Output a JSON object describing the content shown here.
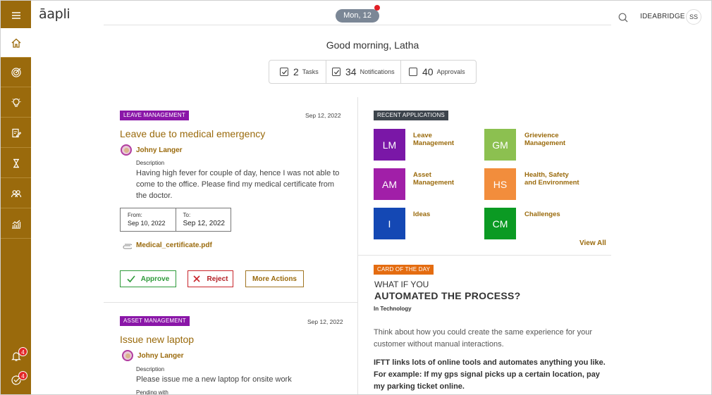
{
  "header": {
    "logo": "āapli",
    "date": "Mon, 12",
    "org": "IDEABRIDGE",
    "user_initials": "SS"
  },
  "greeting": "Good morning, Latha",
  "summary": [
    {
      "count": "2",
      "label": "Tasks",
      "checked": true
    },
    {
      "count": "34",
      "label": "Notifications",
      "checked": true
    },
    {
      "count": "40",
      "label": "Approvals",
      "checked": false
    }
  ],
  "sidebar": {
    "items": [
      {
        "icon": "menu-icon"
      },
      {
        "icon": "home-icon"
      },
      {
        "icon": "target-icon"
      },
      {
        "icon": "lightbulb-icon"
      },
      {
        "icon": "edit-note-icon"
      },
      {
        "icon": "trophy-icon"
      },
      {
        "icon": "users-icon"
      },
      {
        "icon": "analytics-icon"
      }
    ],
    "bell_badge": "4",
    "tasks_badge": "4"
  },
  "card1": {
    "tag": "LEAVE MANAGEMENT",
    "date": "Sep 12, 2022",
    "title": "Leave due to medical emergency",
    "user": "Johny Langer",
    "desc_label": "Description",
    "desc_lines": [
      "Having high fever for couple of day, hence I was not able to",
      "come to the office. Please find my medical certificate from",
      "the doctor."
    ],
    "from_label": "From:",
    "from_value": "Sep 10, 2022",
    "to_label": "To:",
    "to_value": "Sep 12, 2022",
    "attachment": "Medical_certificate.pdf",
    "approve": "Approve",
    "reject": "Reject",
    "more": "More Actions"
  },
  "card2": {
    "tag": "ASSET MANAGEMENT",
    "date": "Sep 12, 2022",
    "title": "Issue new laptop",
    "user": "Johny Langer",
    "desc_label": "Description",
    "desc": "Please issue me a new laptop for onsite work",
    "pending_label": "Pending with"
  },
  "recent": {
    "tag": "RECENT APPLICATIONS",
    "apps": [
      {
        "abbr": "LM",
        "line1": "Leave",
        "line2": "Management",
        "color": "#7a17a7"
      },
      {
        "abbr": "GM",
        "line1": "Grievience",
        "line2": "Management",
        "color": "#8cc050"
      },
      {
        "abbr": "AM",
        "line1": "Asset",
        "line2": "Management",
        "color": "#a11fa8"
      },
      {
        "abbr": "HS",
        "line1": "Health, Safety",
        "line2": "and Environment",
        "color": "#f28d3c"
      },
      {
        "abbr": "I",
        "line1": "Ideas",
        "line2": "",
        "color": "#1448b4"
      },
      {
        "abbr": "CM",
        "line1": "Challenges",
        "line2": "",
        "color": "#0b9a23"
      }
    ],
    "view_all": "View All"
  },
  "card_of_day": {
    "tag": "CARD OF THE DAY",
    "subtitle": "WHAT IF YOU",
    "headline": "AUTOMATED THE PROCESS?",
    "category": "In Technology",
    "p1_line1": "Think about how you could create the same experience for your",
    "p1_line2": "customer without manual interactions.",
    "p2_line1": "IFTT links lots of online tools and automates anything you like.",
    "p2_line2": "For example: If my gps signal picks up a certain location, pay",
    "p2_line3": "my parking ticket online."
  },
  "colors": {
    "brand": "#9a6a0c",
    "tag_purple": "#8a16a8",
    "tag_dark": "#3d444c",
    "tag_orange": "#e46c10",
    "approve": "#2e9a3a",
    "reject": "#c8242a"
  }
}
